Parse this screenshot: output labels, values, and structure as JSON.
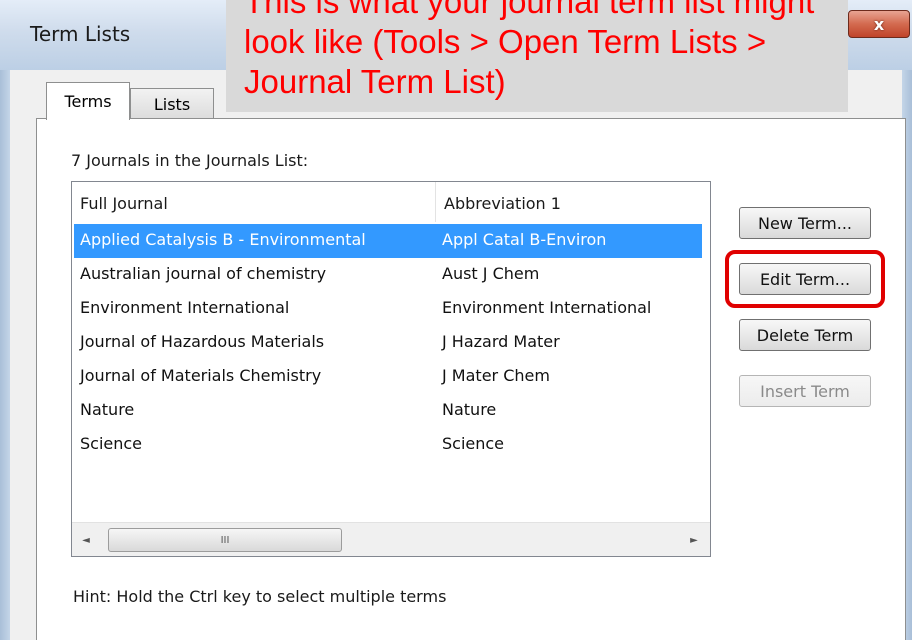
{
  "window": {
    "title": "Term Lists",
    "close_glyph": "x"
  },
  "callout": {
    "text": "This is what your journal term list might look like (Tools > Open Term Lists > Journal Term List)"
  },
  "tabs": [
    {
      "label": "Terms",
      "active": true
    },
    {
      "label": "Lists",
      "active": false
    }
  ],
  "terms_panel": {
    "count_label": "7 Journals in the Journals List:",
    "columns": [
      "Full Journal",
      "Abbreviation 1"
    ],
    "rows": [
      {
        "full": "Applied Catalysis B - Environmental",
        "abbr": "Appl Catal B-Environ",
        "selected": true
      },
      {
        "full": "Australian journal of chemistry",
        "abbr": "Aust J Chem"
      },
      {
        "full": "Environment International",
        "abbr": "Environment International"
      },
      {
        "full": "Journal of Hazardous Materials",
        "abbr": "J Hazard Mater"
      },
      {
        "full": "Journal of Materials Chemistry",
        "abbr": "J Mater Chem"
      },
      {
        "full": "Nature",
        "abbr": "Nature"
      },
      {
        "full": "Science",
        "abbr": "Science"
      }
    ],
    "scrollbar": {
      "left_arrow": "◄",
      "right_arrow": "►",
      "thumb_grip": "III"
    },
    "buttons": {
      "new_term": "New Term...",
      "edit_term": "Edit Term...",
      "delete_term": "Delete Term",
      "insert_term": "Insert Term"
    },
    "hint": "Hint: Hold the Ctrl key to select multiple terms"
  },
  "colors": {
    "selection": "#3399ff",
    "highlight": "#e00000",
    "callout_text": "#ff0000",
    "callout_bg": "#d9d9d9"
  }
}
